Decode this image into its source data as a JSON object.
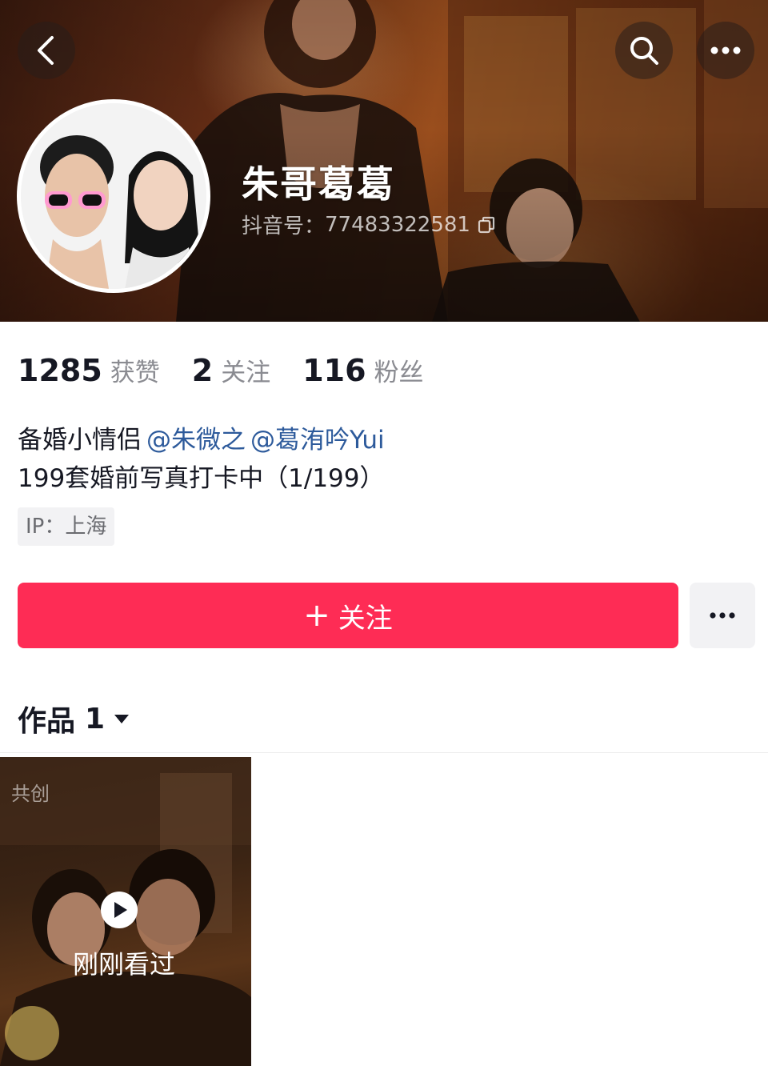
{
  "header": {
    "nickname": "朱哥葛葛",
    "douyin_id_label": "抖音号：",
    "douyin_id": "77483322581",
    "icons": [
      "back-icon",
      "search-icon",
      "more-icon",
      "copy-icon"
    ]
  },
  "stats": [
    {
      "value": "1285",
      "label": "获赞"
    },
    {
      "value": "2",
      "label": "关注"
    },
    {
      "value": "116",
      "label": "粉丝"
    }
  ],
  "bio": {
    "line1_text": "备婚小情侣",
    "mention1": "@朱微之",
    "mention2": "@葛洧吟Yui",
    "line2_text": "199套婚前写真打卡中（1/199）"
  },
  "ip_tag": "IP：上海",
  "actions": {
    "follow_label": "关注",
    "follow_plus": "+"
  },
  "works": {
    "tab_label": "作品",
    "count": "1"
  },
  "video": {
    "badge": "共创",
    "recent_label": "刚刚看过"
  },
  "colors": {
    "accent": "#fe2c55",
    "mention": "#2d5a9b",
    "muted": "#8a8b91"
  }
}
